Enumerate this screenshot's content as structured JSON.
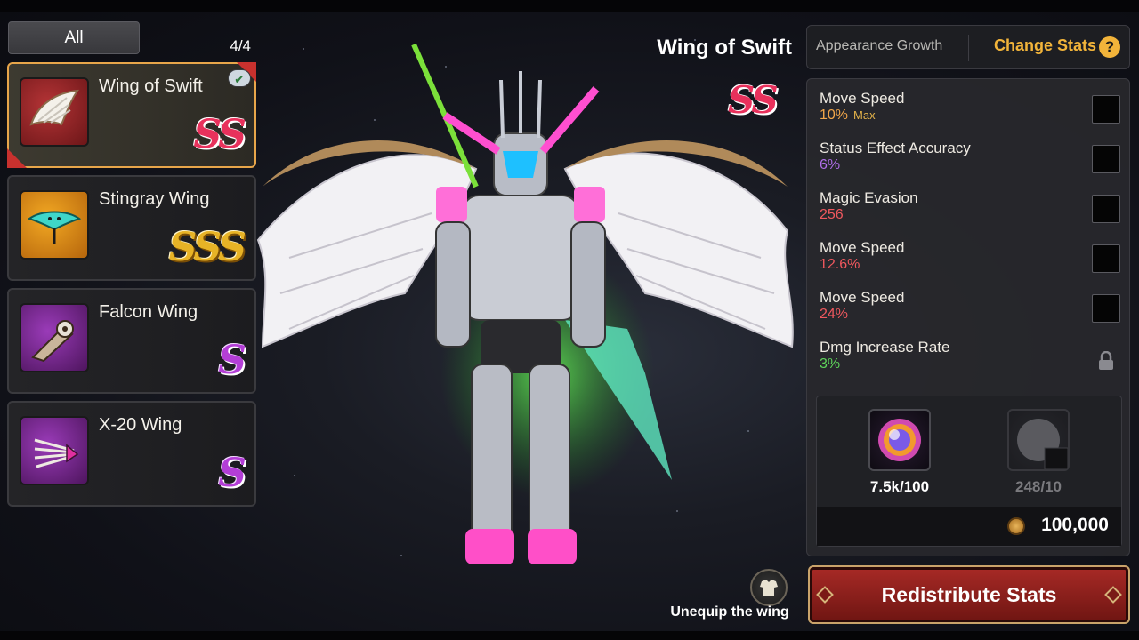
{
  "filter_tab": "All",
  "collection_count": "4/4",
  "wings": [
    {
      "name": "Wing of Swift",
      "grade": "SS"
    },
    {
      "name": "Stingray Wing",
      "grade": "SSS"
    },
    {
      "name": "Falcon Wing",
      "grade": "S"
    },
    {
      "name": "X-20 Wing",
      "grade": "S"
    }
  ],
  "selected": {
    "title": "Wing of Swift",
    "grade": "SS"
  },
  "tabs": {
    "appearance": "Appearance Growth",
    "change_stats": "Change Stats",
    "help": "?"
  },
  "stats": [
    {
      "name": "Move Speed",
      "value": "10%",
      "extra": "Max",
      "value_color": "#f2a64a"
    },
    {
      "name": "Status Effect Accuracy",
      "value": "6%",
      "extra": "",
      "value_color": "#b06ee8"
    },
    {
      "name": "Magic Evasion",
      "value": "256",
      "extra": "",
      "value_color": "#f0585e"
    },
    {
      "name": "Move Speed",
      "value": "12.6%",
      "extra": "",
      "value_color": "#f0585e"
    },
    {
      "name": "Move Speed",
      "value": "24%",
      "extra": "",
      "value_color": "#f0585e"
    },
    {
      "name": "Dmg Increase Rate",
      "value": "3%",
      "extra": "",
      "value_color": "#5ed45a"
    }
  ],
  "materials": [
    {
      "count": "7.5k/100"
    },
    {
      "count": "248/10"
    }
  ],
  "cost": "100,000",
  "unequip_label": "Unequip the wing",
  "redistribute_label": "Redistribute Stats",
  "colors": {
    "accent_gold": "#f2b43a",
    "selected_border": "#e8a64a",
    "button_red": "#a82a26"
  }
}
